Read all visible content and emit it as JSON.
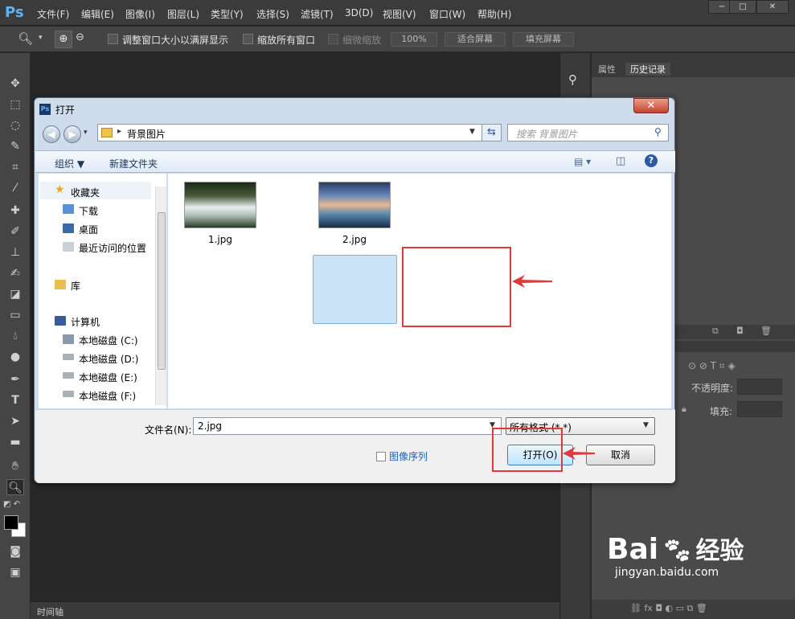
{
  "app": {
    "logo": "Ps",
    "menu": [
      "文件(F)",
      "编辑(E)",
      "图像(I)",
      "图层(L)",
      "类型(Y)",
      "选择(S)",
      "滤镜(T)",
      "3D(D)",
      "视图(V)",
      "窗口(W)",
      "帮助(H)"
    ],
    "window_controls": [
      "−",
      "□",
      "✕"
    ]
  },
  "options": {
    "resize_windows": "调整窗口大小以满屏显示",
    "zoom_all": "缩放所有窗口",
    "scrubby_zoom": "细微缩放",
    "zoom_pct": "100%",
    "fit_screen": "适合屏幕",
    "fill_screen": "填充屏幕"
  },
  "panel": {
    "tabs": [
      "属性",
      "历史记录"
    ],
    "opacity_label": "不透明度:",
    "fill_label": "填充:"
  },
  "timeline_label": "时间轴",
  "dialog": {
    "title": "打开",
    "path_arrow": "▸",
    "path": "背景图片",
    "search_placeholder": "搜索 背景图片",
    "organize": "组织 ▼",
    "new_folder": "新建文件夹",
    "nav": {
      "favorites": "收藏夹",
      "downloads": "下载",
      "desktop": "桌面",
      "recent": "最近访问的位置",
      "library": "库",
      "computer": "计算机",
      "drive_c": "本地磁盘 (C:)",
      "drive_d": "本地磁盘 (D:)",
      "drive_e": "本地磁盘 (E:)",
      "drive_f": "本地磁盘 (F:)"
    },
    "files": [
      {
        "name": "1.jpg",
        "thumb": "waterfall"
      },
      {
        "name": "2.jpg",
        "thumb": "beach-sunset",
        "selected": true
      }
    ],
    "filename_label": "文件名(N):",
    "filename_value": "2.jpg",
    "format_value": "所有格式 (*.*)",
    "image_sequence": "图像序列",
    "open_button": "打开(O)",
    "cancel_button": "取消"
  },
  "watermark": {
    "brand": "Bai",
    "brand2": "经验",
    "url": "jingyan.baidu.com"
  },
  "colors": {
    "accent_red": "#e0393a",
    "ps_blue": "#5fb3f5"
  }
}
